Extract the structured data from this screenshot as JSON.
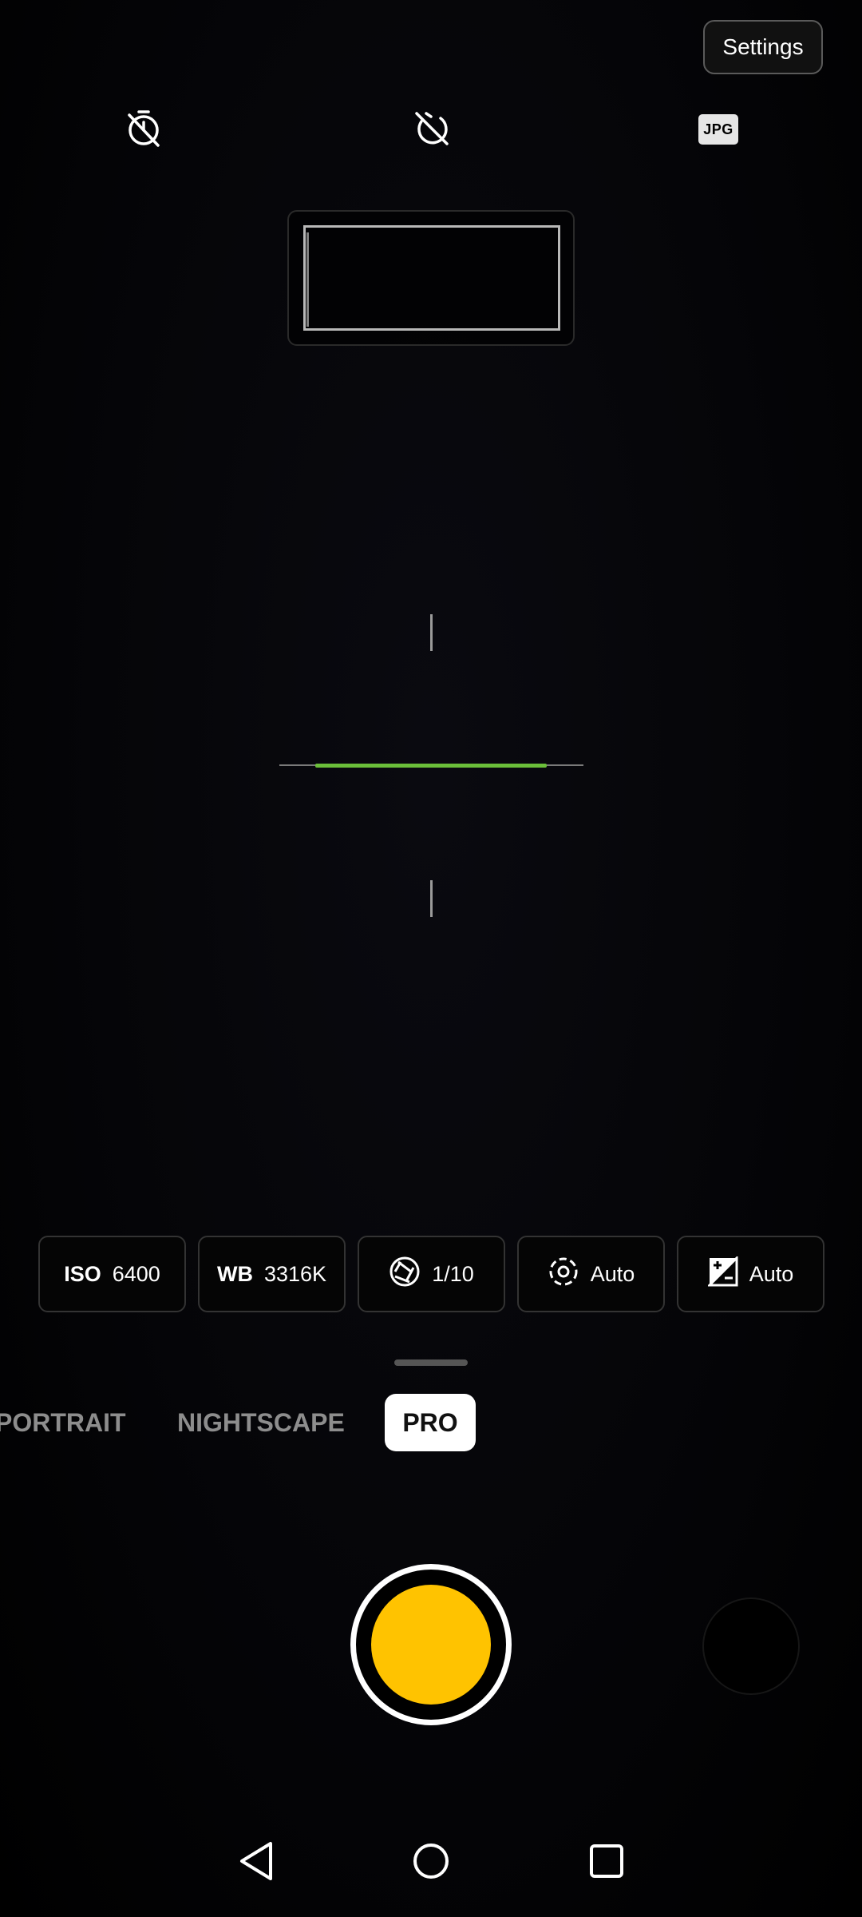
{
  "header": {
    "settings_label": "Settings",
    "icons": [
      "timer-off-icon",
      "motion-off-icon",
      "jpg-format-icon"
    ],
    "format_label": "JPG"
  },
  "histogram": {
    "visible": true
  },
  "pro_controls": [
    {
      "label": "ISO",
      "value": "6400",
      "icon": null
    },
    {
      "label": "WB",
      "value": "3316K",
      "icon": null
    },
    {
      "label": "",
      "value": "1/10",
      "icon": "shutter-speed-icon"
    },
    {
      "label": "",
      "value": "Auto",
      "icon": "focus-icon"
    },
    {
      "label": "",
      "value": "Auto",
      "icon": "exposure-icon"
    }
  ],
  "modes": {
    "items": [
      "PORTRAIT",
      "NIGHTSCAPE",
      "PRO"
    ],
    "active": "PRO"
  },
  "colors": {
    "shutter": "#ffc300",
    "level_indicator": "#6bbf3a",
    "active_mode_bg": "#ffffff"
  },
  "nav": {
    "icons": [
      "back-icon",
      "home-icon",
      "recents-icon"
    ]
  }
}
